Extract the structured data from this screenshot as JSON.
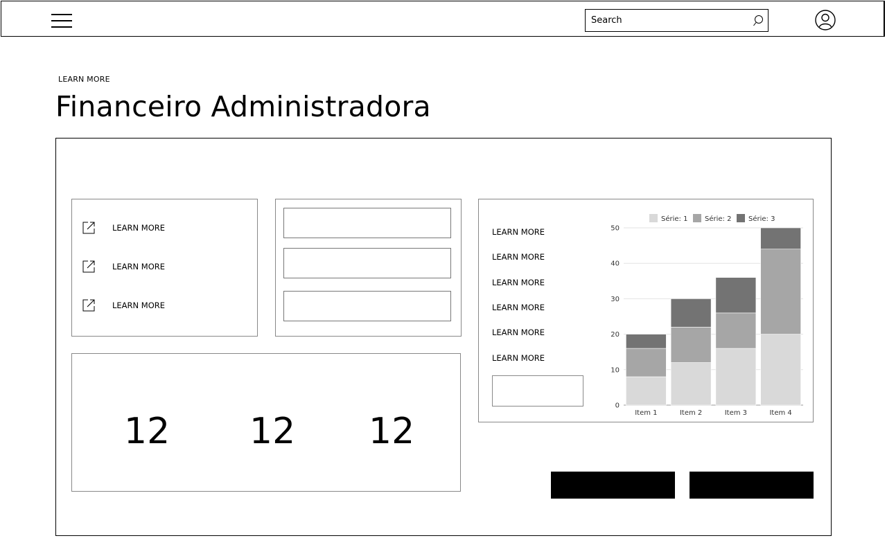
{
  "header": {
    "search": {
      "placeholder": "Search"
    }
  },
  "eyebrow": "LEARN MORE",
  "title": "Financeiro Administradora",
  "links_card": {
    "items": [
      {
        "label": "LEARN MORE",
        "icon": "external-link-icon"
      },
      {
        "label": "LEARN MORE",
        "icon": "external-link-icon"
      },
      {
        "label": "LEARN MORE",
        "icon": "external-link-icon"
      }
    ]
  },
  "stats": {
    "values": [
      "12",
      "12",
      "12"
    ]
  },
  "chart_panel": {
    "links": [
      "LEARN MORE",
      "LEARN MORE",
      "LEARN MORE",
      "LEARN MORE",
      "LEARN MORE",
      "LEARN MORE"
    ]
  },
  "chart_data": {
    "type": "bar",
    "stacked": true,
    "categories": [
      "Item 1",
      "Item 2",
      "Item 3",
      "Item 4"
    ],
    "series": [
      {
        "name": "Série: 1",
        "values": [
          8,
          12,
          16,
          20
        ],
        "color": "#d9d9d9"
      },
      {
        "name": "Série: 2",
        "values": [
          8,
          10,
          10,
          24
        ],
        "color": "#a6a6a6"
      },
      {
        "name": "Série: 3",
        "values": [
          4,
          8,
          10,
          6
        ],
        "color": "#737373"
      }
    ],
    "ylim": [
      0,
      50
    ],
    "yticks": [
      0,
      10,
      20,
      30,
      40,
      50
    ],
    "legend": "top",
    "grid": true
  },
  "colors": {
    "primary_button": "#000000"
  }
}
